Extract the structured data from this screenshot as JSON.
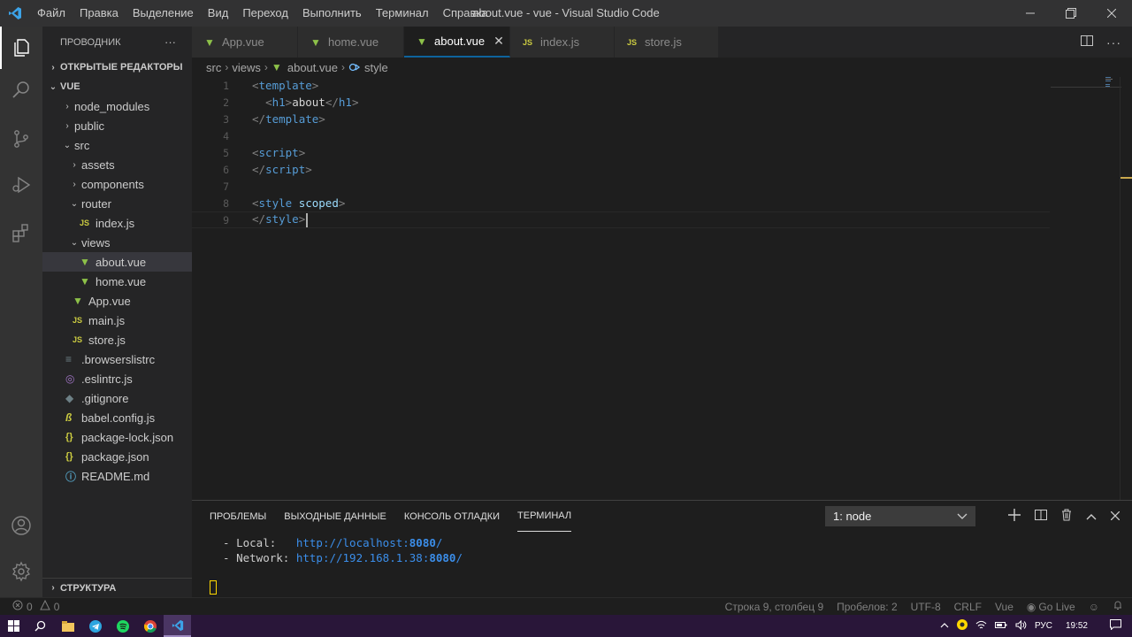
{
  "window": {
    "title": "about.vue - vue - Visual Studio Code",
    "menu": [
      "Файл",
      "Правка",
      "Выделение",
      "Вид",
      "Переход",
      "Выполнить",
      "Терминал",
      "Справка"
    ]
  },
  "sidebar": {
    "title": "ПРОВОДНИК",
    "more": "···",
    "open_editors": "ОТКРЫТЫЕ РЕДАКТОРЫ",
    "workspace": "VUE",
    "tree": [
      {
        "label": "node_modules",
        "type": "folder",
        "depth": 1,
        "state": "closed"
      },
      {
        "label": "public",
        "type": "folder",
        "depth": 1,
        "state": "closed"
      },
      {
        "label": "src",
        "type": "folder",
        "depth": 1,
        "state": "open"
      },
      {
        "label": "assets",
        "type": "folder",
        "depth": 2,
        "state": "closed"
      },
      {
        "label": "components",
        "type": "folder",
        "depth": 2,
        "state": "closed"
      },
      {
        "label": "router",
        "type": "folder",
        "depth": 2,
        "state": "open"
      },
      {
        "label": "index.js",
        "type": "js",
        "depth": 3
      },
      {
        "label": "views",
        "type": "folder",
        "depth": 2,
        "state": "open"
      },
      {
        "label": "about.vue",
        "type": "vue",
        "depth": 3,
        "selected": true
      },
      {
        "label": "home.vue",
        "type": "vue",
        "depth": 3
      },
      {
        "label": "App.vue",
        "type": "vue",
        "depth": 2
      },
      {
        "label": "main.js",
        "type": "js",
        "depth": 2
      },
      {
        "label": "store.js",
        "type": "js",
        "depth": 2
      },
      {
        "label": ".browserslistrc",
        "type": "txt",
        "depth": 1
      },
      {
        "label": ".eslintrc.js",
        "type": "cfg",
        "depth": 1
      },
      {
        "label": ".gitignore",
        "type": "git",
        "depth": 1
      },
      {
        "label": "babel.config.js",
        "type": "babel",
        "depth": 1
      },
      {
        "label": "package-lock.json",
        "type": "json",
        "depth": 1
      },
      {
        "label": "package.json",
        "type": "json",
        "depth": 1
      },
      {
        "label": "README.md",
        "type": "info",
        "depth": 1
      }
    ],
    "outline": "СТРУКТУРА"
  },
  "tabs": [
    {
      "label": "App.vue",
      "type": "vue",
      "active": false
    },
    {
      "label": "home.vue",
      "type": "vue",
      "active": false
    },
    {
      "label": "about.vue",
      "type": "vue",
      "active": true
    },
    {
      "label": "index.js",
      "type": "js",
      "active": false
    },
    {
      "label": "store.js",
      "type": "js",
      "active": false
    }
  ],
  "breadcrumb": [
    "src",
    "views",
    "about.vue",
    "style"
  ],
  "editor": {
    "lines": [
      [
        {
          "c": "tg",
          "t": "<"
        },
        {
          "c": "tn",
          "t": "template"
        },
        {
          "c": "tg",
          "t": ">"
        }
      ],
      [
        {
          "c": "tx",
          "t": "  "
        },
        {
          "c": "tg",
          "t": "<"
        },
        {
          "c": "tn",
          "t": "h1"
        },
        {
          "c": "tg",
          "t": ">"
        },
        {
          "c": "tx",
          "t": "about"
        },
        {
          "c": "tg",
          "t": "</"
        },
        {
          "c": "tn",
          "t": "h1"
        },
        {
          "c": "tg",
          "t": ">"
        }
      ],
      [
        {
          "c": "tg",
          "t": "</"
        },
        {
          "c": "tn",
          "t": "template"
        },
        {
          "c": "tg",
          "t": ">"
        }
      ],
      [],
      [
        {
          "c": "tg",
          "t": "<"
        },
        {
          "c": "tn",
          "t": "script"
        },
        {
          "c": "tg",
          "t": ">"
        }
      ],
      [
        {
          "c": "tg",
          "t": "</"
        },
        {
          "c": "tn",
          "t": "script"
        },
        {
          "c": "tg",
          "t": ">"
        }
      ],
      [],
      [
        {
          "c": "tg",
          "t": "<"
        },
        {
          "c": "tn",
          "t": "style"
        },
        {
          "c": "tx",
          "t": " "
        },
        {
          "c": "at",
          "t": "scoped"
        },
        {
          "c": "tg",
          "t": ">"
        }
      ],
      [
        {
          "c": "tg",
          "t": "</"
        },
        {
          "c": "tn",
          "t": "style"
        },
        {
          "c": "tg",
          "t": ">"
        }
      ]
    ],
    "current_line": 9
  },
  "panel": {
    "tabs": [
      "ПРОБЛЕМЫ",
      "ВЫХОДНЫЕ ДАННЫЕ",
      "КОНСОЛЬ ОТЛАДКИ",
      "ТЕРМИНАЛ"
    ],
    "active_tab": 3,
    "terminal_select": "1: node",
    "terminal": {
      "local_label": "  - Local:   ",
      "local_url_pre": "http://localhost:",
      "local_port": "8080",
      "local_url_post": "/",
      "network_label": "  - Network: ",
      "network_url_pre": "http://192.168.1.38:",
      "network_port": "8080",
      "network_url_post": "/"
    }
  },
  "status": {
    "errors": "0",
    "warnings": "0",
    "position": "Строка 9, столбец 9",
    "spaces": "Пробелов: 2",
    "encoding": "UTF-8",
    "eol": "CRLF",
    "language": "Vue",
    "golive": "Go Live"
  },
  "taskbar": {
    "lang": "РУС",
    "time": "19:52"
  }
}
